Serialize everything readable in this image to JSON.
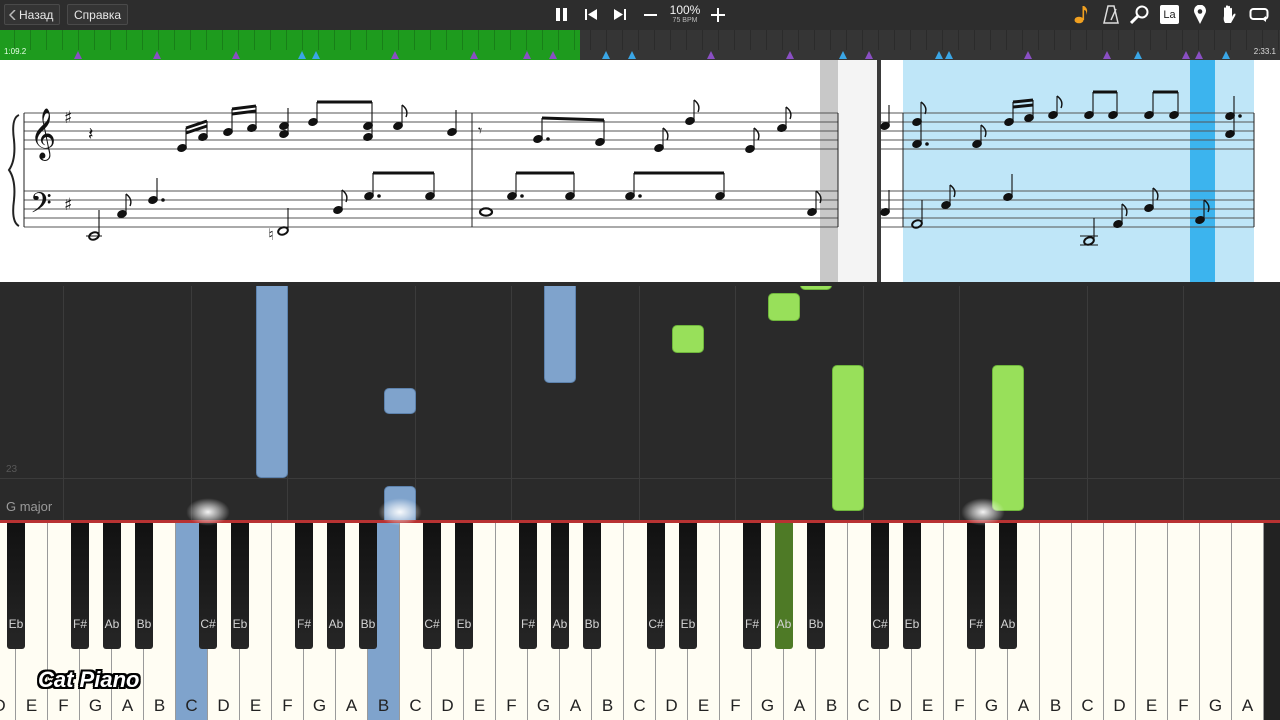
{
  "toolbar": {
    "back_label": "Назад",
    "help_label": "Справка",
    "zoom_percent": "100%",
    "bpm": "75 BPM",
    "playback_icons": [
      "pause-icon",
      "previous-icon",
      "next-icon",
      "minus-icon",
      "plus-icon"
    ],
    "right_icons": [
      "note-icon",
      "metronome-icon",
      "search-icon",
      "la-icon",
      "location-icon",
      "hand-icon",
      "loop-icon"
    ],
    "la_label": "La"
  },
  "timeline": {
    "start_time": "1:09.2",
    "end_time": "2:33.1",
    "progress_fraction": 0.453,
    "colors": {
      "played": "#1e9b1e",
      "remaining": "#353535",
      "left_hand_marker": "#8a4fc4",
      "right_hand_marker": "#3aa6e6"
    }
  },
  "piano_roll": {
    "measure_number": "23",
    "key_signature_label": "G major",
    "colors": {
      "left_hand": "#7fa3cc",
      "right_hand": "#98e05a",
      "highlight": "#bfe6f8"
    }
  },
  "keyboard": {
    "white_keys": [
      "D",
      "E",
      "F",
      "G",
      "A",
      "B",
      "C",
      "D",
      "E",
      "F",
      "G",
      "A",
      "B",
      "C",
      "D",
      "E",
      "F",
      "G",
      "A",
      "B",
      "C",
      "D",
      "E",
      "F",
      "G",
      "A",
      "B",
      "C",
      "D",
      "E",
      "F",
      "G",
      "A",
      "B",
      "C",
      "D",
      "E",
      "F",
      "G",
      "A"
    ],
    "black_keys": [
      "Eb",
      "F#",
      "Ab",
      "Bb",
      "C#",
      "Eb",
      "F#",
      "Ab",
      "Bb",
      "C#",
      "Eb",
      "F#",
      "Ab",
      "Bb",
      "C#",
      "Eb",
      "F#",
      "Ab",
      "Bb",
      "C#",
      "Eb",
      "F#",
      "Ab"
    ],
    "left_edge_black_label": "#",
    "pressed_white_key_indices": [
      6,
      12
    ],
    "pressed_black_key_indices": [
      17
    ]
  },
  "watermark": "Cat Piano"
}
